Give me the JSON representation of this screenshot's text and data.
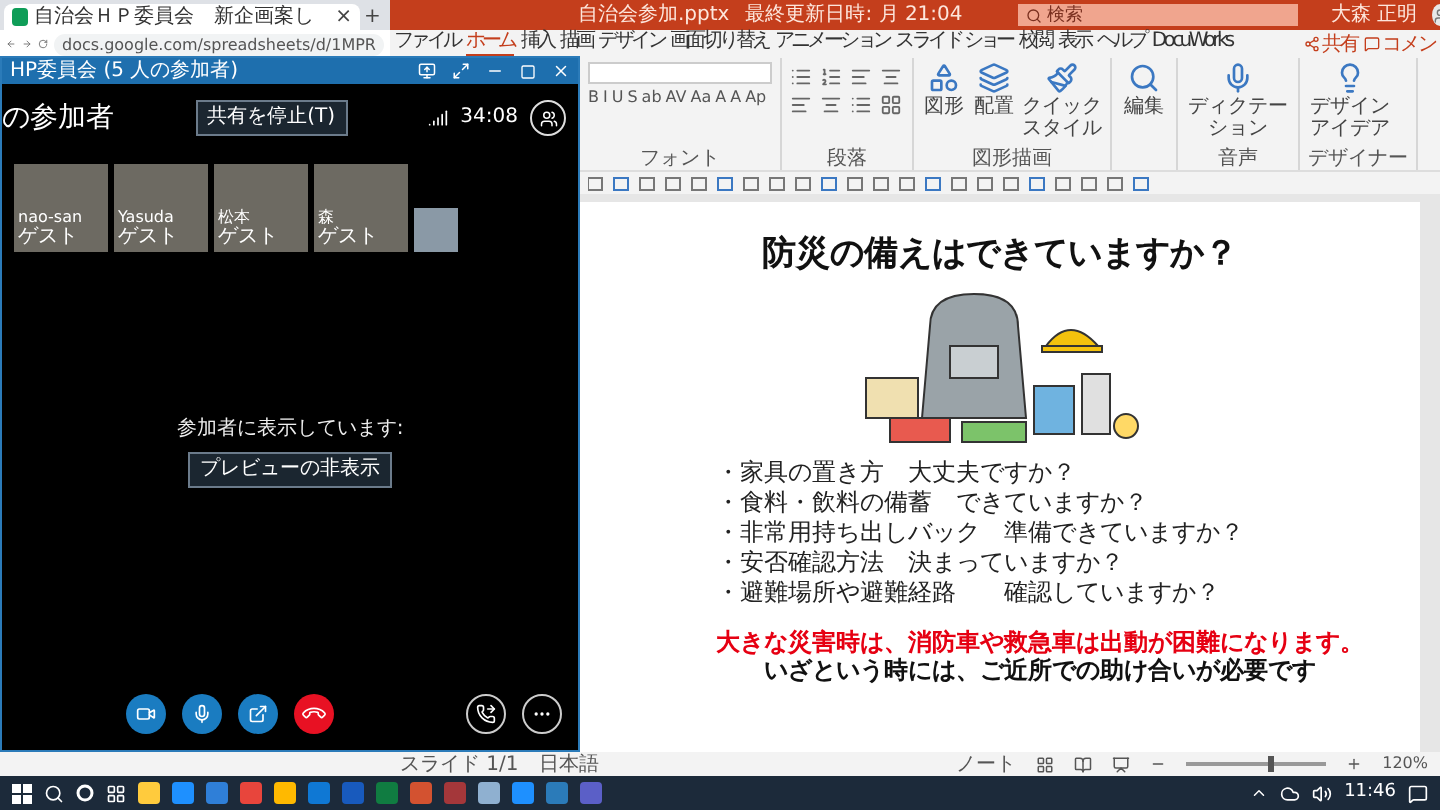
{
  "browser": {
    "tab_title": "自治会ＨＰ委員会　新企画案し",
    "tab_close": "×",
    "new_tab": "+",
    "address": "docs.google.com/spreadsheets/d/1MPR"
  },
  "powerpoint": {
    "file_name": "自治会参加.pptx",
    "saved": "最終更新日時: 月 21:04",
    "search": {
      "placeholder": "検索"
    },
    "user": "大森 正明",
    "menu": [
      {
        "label": "ファイル",
        "selected": false
      },
      {
        "label": "ホーム",
        "selected": true
      },
      {
        "label": "挿入",
        "selected": false
      },
      {
        "label": "描画",
        "selected": false
      },
      {
        "label": "デザイン",
        "selected": false
      },
      {
        "label": "画面切り替え",
        "selected": false
      },
      {
        "label": "アニメーション",
        "selected": false
      },
      {
        "label": "スライド ショー",
        "selected": false
      },
      {
        "label": "校閲",
        "selected": false
      },
      {
        "label": "表示",
        "selected": false
      },
      {
        "label": "ヘルプ",
        "selected": false
      },
      {
        "label": "DocuWorks",
        "selected": false
      }
    ],
    "share": "共有",
    "comment": "コメン",
    "ribbon": [
      {
        "kind": "font",
        "label": "フォント",
        "buttons": [
          "B",
          "I",
          "U",
          "S",
          "ab",
          "AV",
          "Aa",
          "A",
          "A",
          "Ap"
        ]
      },
      {
        "kind": "paragraph",
        "label": "段落"
      },
      {
        "kind": "buttons",
        "label": "図形描画",
        "buttons": [
          "図形",
          "配置",
          "クイックスタイル"
        ]
      },
      {
        "kind": "buttons",
        "buttons": [
          "編集"
        ]
      },
      {
        "kind": "buttons",
        "label": "音声",
        "buttons": [
          "ディクテーション"
        ]
      },
      {
        "kind": "buttons",
        "label": "デザイナー",
        "buttons": [
          "デザインアイデア"
        ]
      }
    ],
    "slide": {
      "title": "防災の備えはできていますか？",
      "bullets": [
        "・家具の置き方　大丈夫ですか？",
        "・食料・飲料の備蓄　できていますか？",
        "・非常用持ち出しバック　準備できていますか？",
        "・安否確認方法　決まっていますか？",
        "・避難場所や避難経路　　確認していますか？"
      ],
      "warning": "大きな災害時は、消防車や救急車は出動が困難になります。",
      "note": "いざという時には、ご近所での助け合いが必要です"
    },
    "status_bar": {
      "slide": "スライド 1/1",
      "language": "日本語",
      "notes": "ノート",
      "zoom": "120%",
      "zoom_slider": {
        "level": 0.6
      }
    }
  },
  "meeting": {
    "title": "HP委員会 (5 人の参加者)",
    "heading": "の参加者",
    "stop_sharing": "共有を停止(T)",
    "timer": "34:08",
    "participants": [
      {
        "name": "nao-san",
        "role": "ゲスト"
      },
      {
        "name": "Yasuda",
        "role": "ゲスト"
      },
      {
        "name": "松本",
        "role": "ゲスト"
      },
      {
        "name": "森",
        "role": "ゲスト"
      }
    ],
    "presenting": "参加者に表示しています:",
    "hide_preview": "プレビューの非表示"
  },
  "taskbar": {
    "clock": "11:46"
  }
}
